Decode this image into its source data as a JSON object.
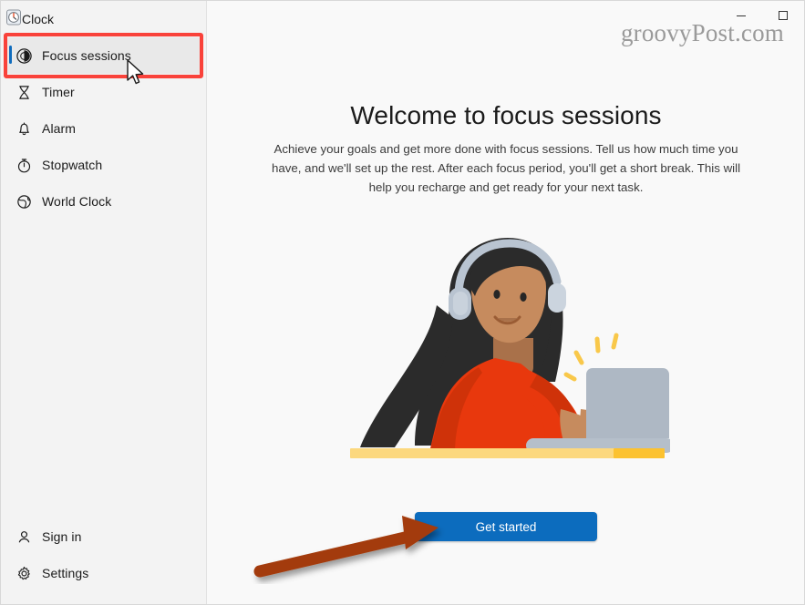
{
  "window": {
    "app_title": "Clock",
    "app_icon": "clock-icon",
    "controls": {
      "minimize": "–",
      "maximize": "□"
    }
  },
  "watermark": {
    "text": "groovyPost.com"
  },
  "sidebar": {
    "items": [
      {
        "label": "Focus sessions",
        "icon": "focus-sessions-icon",
        "selected": true
      },
      {
        "label": "Timer",
        "icon": "hourglass-icon",
        "selected": false
      },
      {
        "label": "Alarm",
        "icon": "bell-icon",
        "selected": false
      },
      {
        "label": "Stopwatch",
        "icon": "stopwatch-icon",
        "selected": false
      },
      {
        "label": "World Clock",
        "icon": "globe-icon",
        "selected": false
      }
    ],
    "bottom_items": [
      {
        "label": "Sign in",
        "icon": "person-icon"
      },
      {
        "label": "Settings",
        "icon": "gear-icon"
      }
    ],
    "accent_color": "#0f6cbd",
    "selected_background": "#e9e9e9"
  },
  "main": {
    "headline": "Welcome to focus sessions",
    "description": "Achieve your goals and get more done with focus sessions. Tell us how much time you have, and we'll set up the rest. After each focus period, you'll get a short break. This will help you recharge and get ready for your next task.",
    "primary_button": "Get started",
    "primary_button_color": "#0c6cbe",
    "illustration": {
      "name": "woman-with-headphones-at-laptop",
      "colors": {
        "hair": "#2b2b2b",
        "skin": "#c68b5e",
        "skin_shadow": "#a9714a",
        "sweater": "#e8380d",
        "sweater_shadow": "#cf3209",
        "headphones": "#b9c4d1",
        "laptop": "#aeb8c4",
        "laptop_base": "#b5bfca",
        "desk_light": "#fcd87e",
        "desk_bright": "#fcc230",
        "sparkle": "#f9c84a"
      }
    }
  },
  "annotations": {
    "highlight_box_color": "#f9423a",
    "arrow_color": "#a33a09",
    "cursor": "mouse-pointer"
  }
}
